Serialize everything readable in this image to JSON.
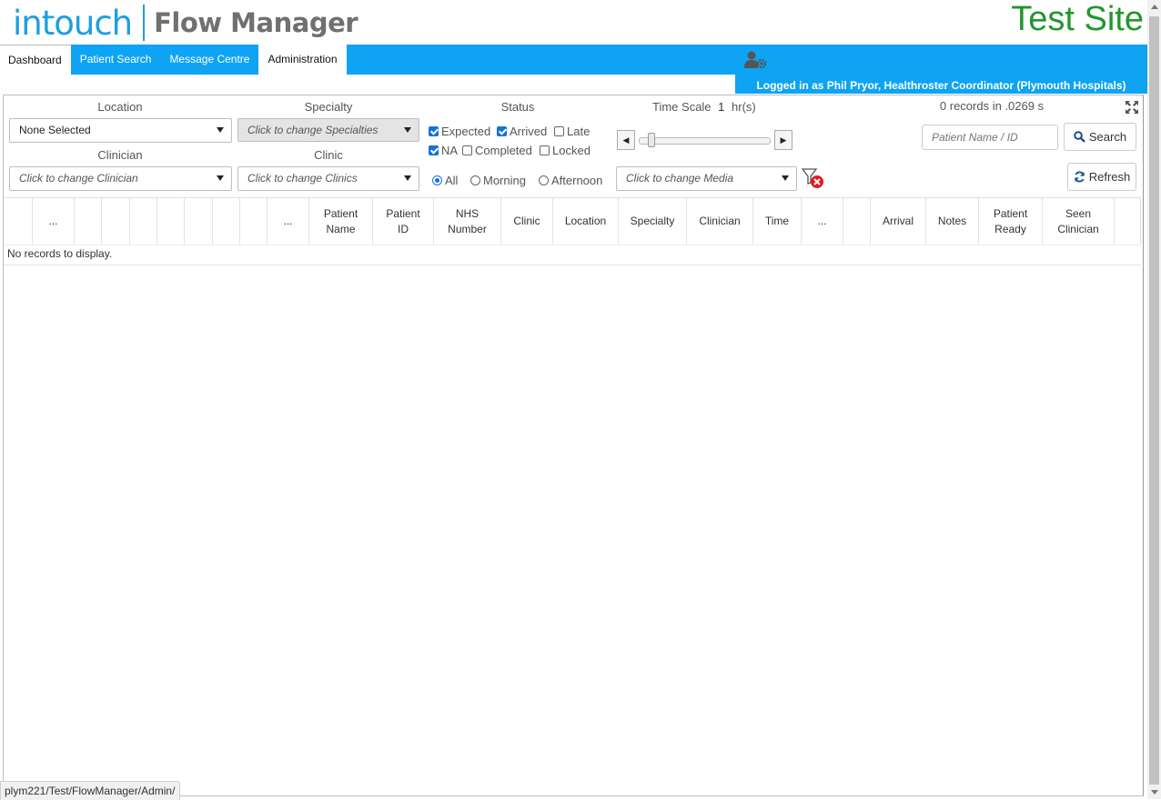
{
  "header": {
    "brand": "intouch",
    "product": "Flow Manager",
    "site_label": "Test Site"
  },
  "nav": {
    "tabs": [
      {
        "label": "Dashboard",
        "active": true
      },
      {
        "label": "Patient Search",
        "active": false
      },
      {
        "label": "Message Centre",
        "active": false
      },
      {
        "label": "Administration",
        "active": true
      }
    ],
    "logged_in_text": "Logged in as Phil Pryor, Healthroster Coordinator (Plymouth Hospitals)",
    "user_settings_icon": "user-gear-icon"
  },
  "filters": {
    "location": {
      "label": "Location",
      "value": "None Selected"
    },
    "specialty": {
      "label": "Specialty",
      "value": "Click to change Specialties"
    },
    "clinician": {
      "label": "Clinician",
      "value": "Click to change Clinician"
    },
    "clinic": {
      "label": "Clinic",
      "value": "Click to change Clinics"
    },
    "status": {
      "label": "Status",
      "options": [
        {
          "label": "Expected",
          "checked": true
        },
        {
          "label": "Arrived",
          "checked": true
        },
        {
          "label": "Late",
          "checked": false
        },
        {
          "label": "NA",
          "checked": true
        },
        {
          "label": "Completed",
          "checked": false
        },
        {
          "label": "Locked",
          "checked": false
        }
      ]
    },
    "period": {
      "options": [
        {
          "label": "All",
          "selected": true
        },
        {
          "label": "Morning",
          "selected": false
        },
        {
          "label": "Afternoon",
          "selected": false
        }
      ]
    },
    "time_scale": {
      "label": "Time Scale",
      "value": "1",
      "unit": "hr(s)"
    },
    "media": {
      "value": "Click to change Media"
    },
    "records_info": "0 records in .0269 s",
    "patient_search": {
      "placeholder": "Patient Name / ID"
    },
    "search_button": "Search",
    "refresh_button": "Refresh"
  },
  "grid": {
    "columns": [
      "",
      "...",
      "",
      "",
      "",
      "",
      "",
      "",
      "",
      "...",
      "Patient Name",
      "Patient ID",
      "NHS Number",
      "Clinic",
      "Location",
      "Specialty",
      "Clinician",
      "Time",
      "...",
      "",
      "Arrival",
      "Notes",
      "Patient Ready",
      "Seen Clinician",
      ""
    ],
    "empty_message": "No records to display."
  },
  "status_bar": {
    "url": "plym221/Test/FlowManager/Admin/"
  },
  "colors": {
    "accent": "#0ea3f3",
    "brand": "#1e9ee0",
    "site": "#22962d",
    "checkbox": "#1672d8"
  }
}
